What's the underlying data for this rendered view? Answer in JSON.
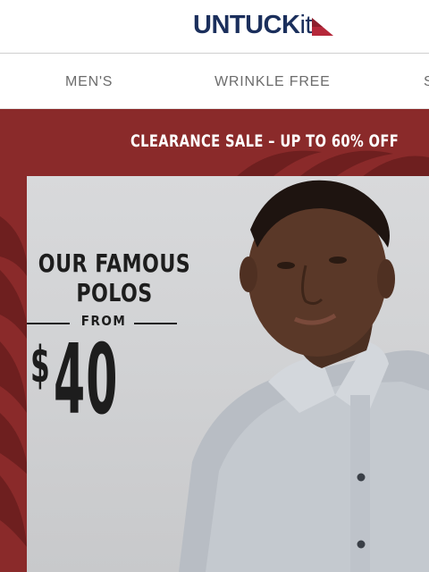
{
  "brand": {
    "logo_main": "UNTUCK",
    "logo_suffix": "it",
    "colors": {
      "navy": "#1b2f5c",
      "accent_red": "#b5283a",
      "banner_red": "#8a2a2a"
    }
  },
  "nav": {
    "items": [
      {
        "label": "MEN'S"
      },
      {
        "label": "WRINKLE FREE"
      },
      {
        "label": "S"
      }
    ]
  },
  "banner": {
    "promo_text": "CLEARANCE SALE – UP TO 60% OFF",
    "headline_line1": "OUR FAMOUS",
    "headline_line2": "POLOS",
    "from_label": "FROM",
    "price_currency": "$",
    "price_value": "40"
  }
}
